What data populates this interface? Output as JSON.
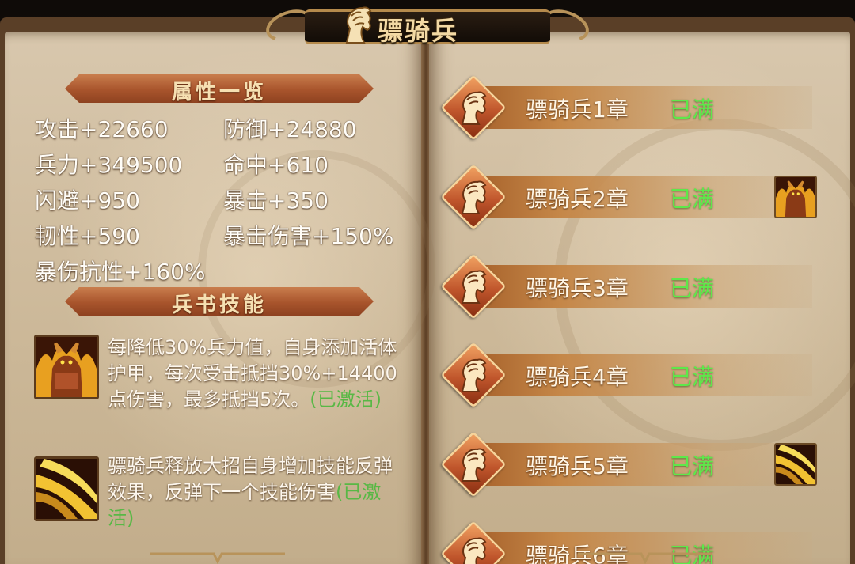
{
  "title": "骠骑兵",
  "left_page": {
    "attributes_header": "属性一览",
    "attributes": [
      {
        "label": "攻击+22660"
      },
      {
        "label": "防御+24880"
      },
      {
        "label": "兵力+349500"
      },
      {
        "label": "命中+610"
      },
      {
        "label": "闪避+950"
      },
      {
        "label": "暴击+350"
      },
      {
        "label": "韧性+590"
      },
      {
        "label": "暴击伤害+150%"
      },
      {
        "label": "暴伤抗性+160%"
      }
    ],
    "skills_header": "兵书技能",
    "skills": [
      {
        "icon": "demon-warrior-icon",
        "text": "每降低30%兵力值，自身添加活体护甲，每次受击抵挡30%+14400点伤害，最多抵挡5次。",
        "status": "(已激活)"
      },
      {
        "icon": "golden-slash-icon",
        "text": "骠骑兵释放大招自身增加技能反弹效果，反弹下一个技能伤害",
        "status": "(已激活)"
      }
    ]
  },
  "right_page": {
    "chapters": [
      {
        "name": "骠骑兵1章",
        "status": "已满",
        "reward_icon": ""
      },
      {
        "name": "骠骑兵2章",
        "status": "已满",
        "reward_icon": "demon-warrior-icon"
      },
      {
        "name": "骠骑兵3章",
        "status": "已满",
        "reward_icon": ""
      },
      {
        "name": "骠骑兵4章",
        "status": "已满",
        "reward_icon": ""
      },
      {
        "name": "骠骑兵5章",
        "status": "已满",
        "reward_icon": "golden-slash-icon"
      },
      {
        "name": "骠骑兵6章",
        "status": "已满",
        "reward_icon": ""
      }
    ]
  },
  "colors": {
    "page": "#d2bf9f",
    "ribbon": "#a8542c",
    "status_green": "#5ee84a",
    "activated_green": "#58b845"
  }
}
